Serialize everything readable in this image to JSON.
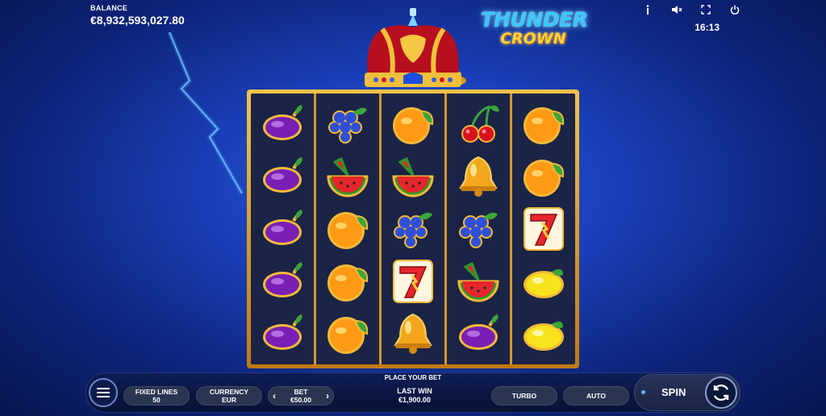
{
  "hud": {
    "balance_label": "BALANCE",
    "balance_value": "€8,932,593,027.80",
    "clock": "16:13",
    "icons": [
      "info-icon",
      "mute-icon",
      "fullscreen-icon",
      "power-icon"
    ]
  },
  "logo": {
    "line1": "THUNDER",
    "line2": "CROWN"
  },
  "reels": [
    [
      "plum",
      "plum",
      "plum",
      "plum",
      "plum"
    ],
    [
      "grapes",
      "watermelon",
      "orange",
      "orange",
      "orange"
    ],
    [
      "orange",
      "watermelon",
      "grapes",
      "seven",
      "bell"
    ],
    [
      "cherry",
      "bell",
      "grapes",
      "watermelon",
      "plum"
    ],
    [
      "orange",
      "orange",
      "seven",
      "lemon",
      "lemon"
    ]
  ],
  "controls": {
    "prompt": "PLACE YOUR BET",
    "fixed_lines_label": "FIXED LINES",
    "fixed_lines_value": "50",
    "currency_label": "CURRENCY",
    "currency_value": "EUR",
    "bet_label": "BET",
    "bet_value": "€50.00",
    "bet_prev": "‹",
    "bet_next": "›",
    "last_win_label": "LAST WIN",
    "last_win_value": "€1,900.00",
    "turbo_label": "TURBO",
    "auto_label": "AUTO",
    "spin_label": "SPIN"
  },
  "colors": {
    "background": "#1a3fb8",
    "frame_gold": "#e0a838",
    "reel_bg": "#1b2446",
    "logo_blue": "#37c8ff",
    "logo_gold": "#ffd23a"
  }
}
